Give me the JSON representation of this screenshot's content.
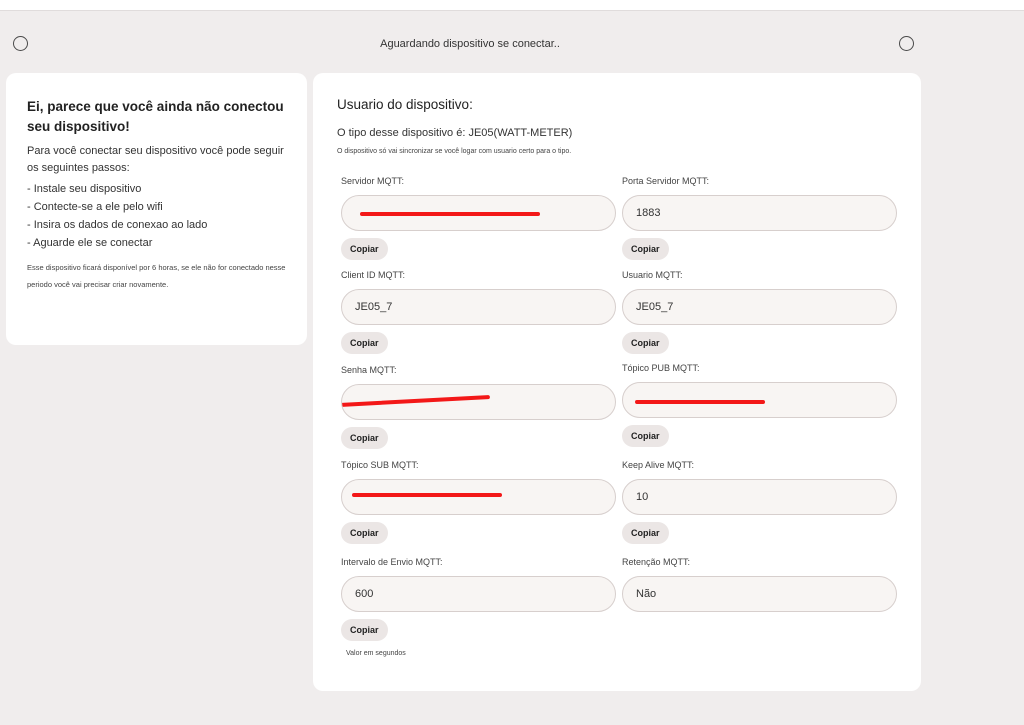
{
  "status_text": "Aguardando dispositivo se conectar..",
  "help": {
    "title": "Ei, parece que você ainda não conectou seu dispositivo!",
    "intro": "Para você conectar seu dispositivo você pode seguir os seguintes passos:",
    "steps": [
      "- Instale seu dispositivo",
      "- Contecte-se a ele pelo wifi",
      "- Insira os dados de conexao ao lado",
      "- Aguarde ele se conectar"
    ],
    "note": "Esse dispositivo ficará disponível por 6 horas, se ele não for conectado nesse periodo você vai precisar criar novamente."
  },
  "device": {
    "title": "Usuario do dispositivo:",
    "type_line": "O tipo desse dispositivo é: JE05(WATT-METER)",
    "sync_note": "O dispositivo só vai sincronizar se você logar com usuario certo para o tipo.",
    "copy_label": "Copiar",
    "fields": [
      {
        "label": "Servidor MQTT:",
        "value": "",
        "redacted": true
      },
      {
        "label": "Porta Servidor MQTT:",
        "value": "1883"
      },
      {
        "label": "Client ID MQTT:",
        "value": "JE05_7"
      },
      {
        "label": "Usuario MQTT:",
        "value": "JE05_7"
      },
      {
        "label": "Senha MQTT:",
        "value": "",
        "redacted": true
      },
      {
        "label": "Tópico PUB MQTT:",
        "value": "",
        "redacted": true
      },
      {
        "label": "Tópico SUB MQTT:",
        "value": "",
        "redacted": true
      },
      {
        "label": "Keep Alive MQTT:",
        "value": "10"
      },
      {
        "label": "Intervalo de Envio MQTT:",
        "value": "600"
      },
      {
        "label": "Retenção MQTT:",
        "value": "Não"
      }
    ],
    "hint": "Valor em segundos"
  },
  "colors": {
    "background": "#f0eded",
    "card": "#ffffff",
    "redaction": "#f31818"
  }
}
